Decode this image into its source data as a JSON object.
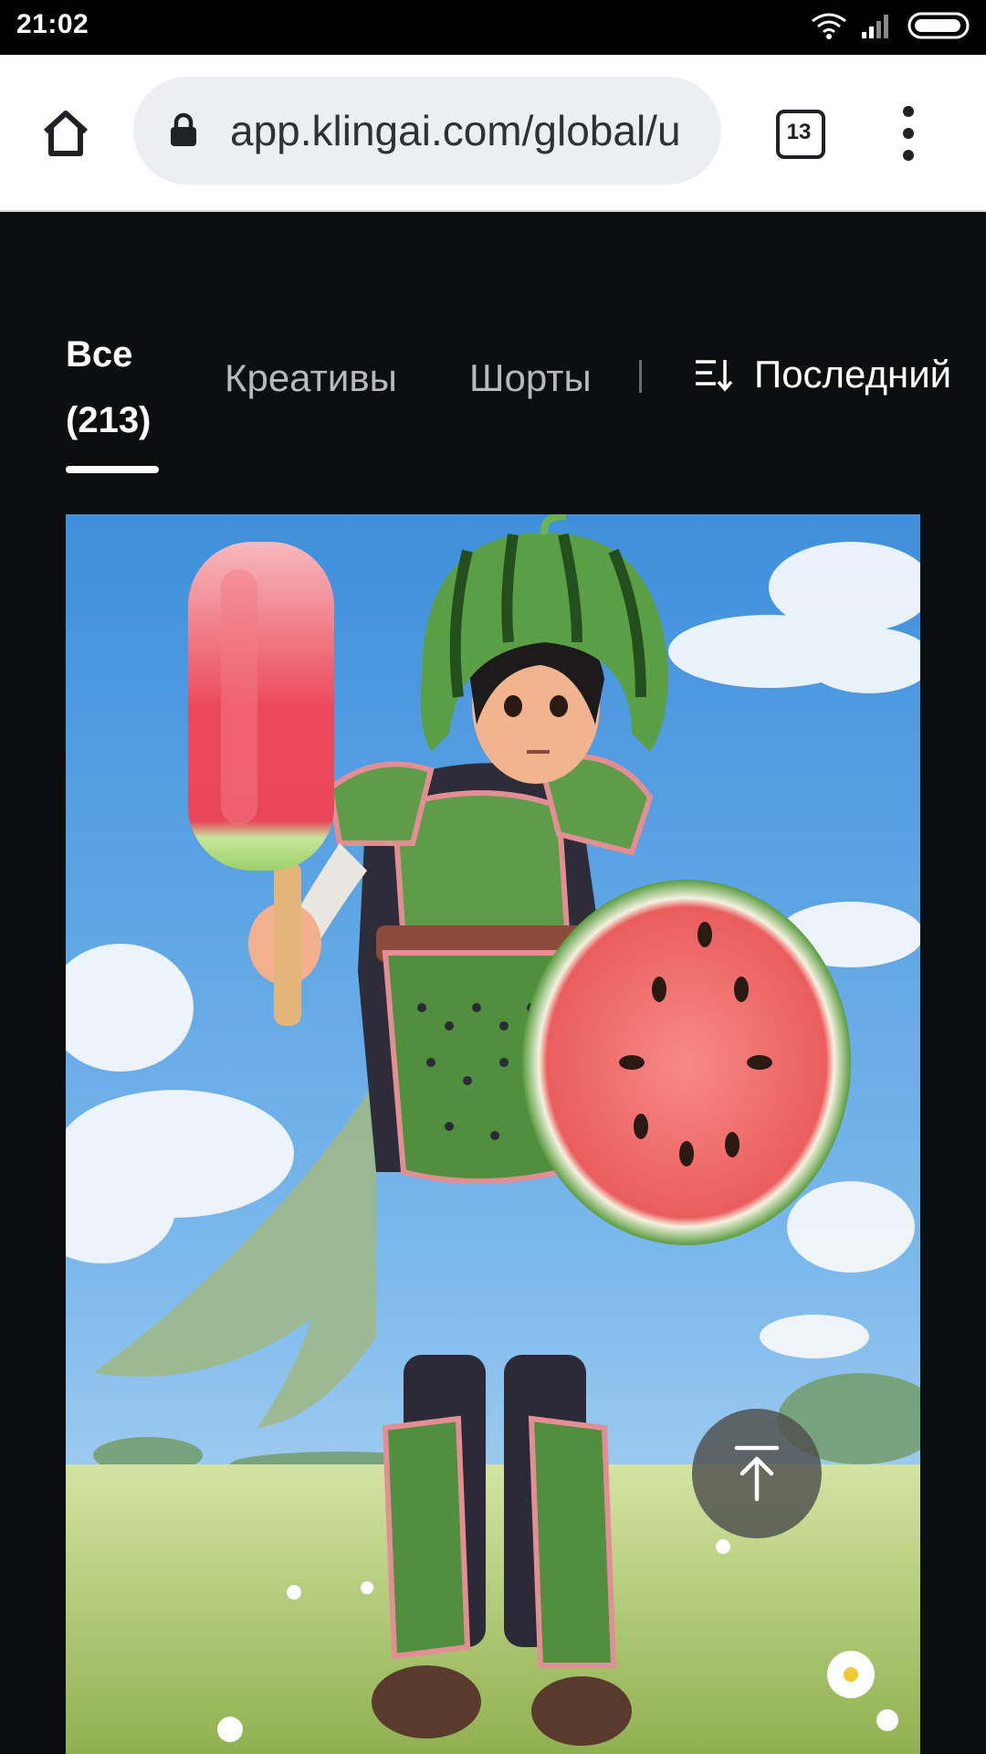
{
  "status_bar": {
    "time": "21:02",
    "icons": [
      "wifi-icon",
      "signal-icon",
      "battery-icon"
    ]
  },
  "browser": {
    "url": "app.klingai.com/global/u",
    "tab_count": "13",
    "icons": [
      "home-icon",
      "lock-icon",
      "more-vert-icon"
    ]
  },
  "filters": {
    "all_label": "Все",
    "all_count": "(213)",
    "creatives_label": "Креативы",
    "shorts_label": "Шорты",
    "sort_label": "Последний",
    "sort_icon": "sort-icon"
  },
  "gallery": {
    "scroll_top_icon": "arrow-up-to-top-icon"
  },
  "colors": {
    "page_bg": "#0d0e0f",
    "browser_bg": "#ffffff",
    "url_bg": "#eceef1",
    "sky": "#4e9be0",
    "grass": "#b9cf7a",
    "watermelon_green": "#4f8f3e",
    "watermelon_red": "#f06a6a"
  }
}
